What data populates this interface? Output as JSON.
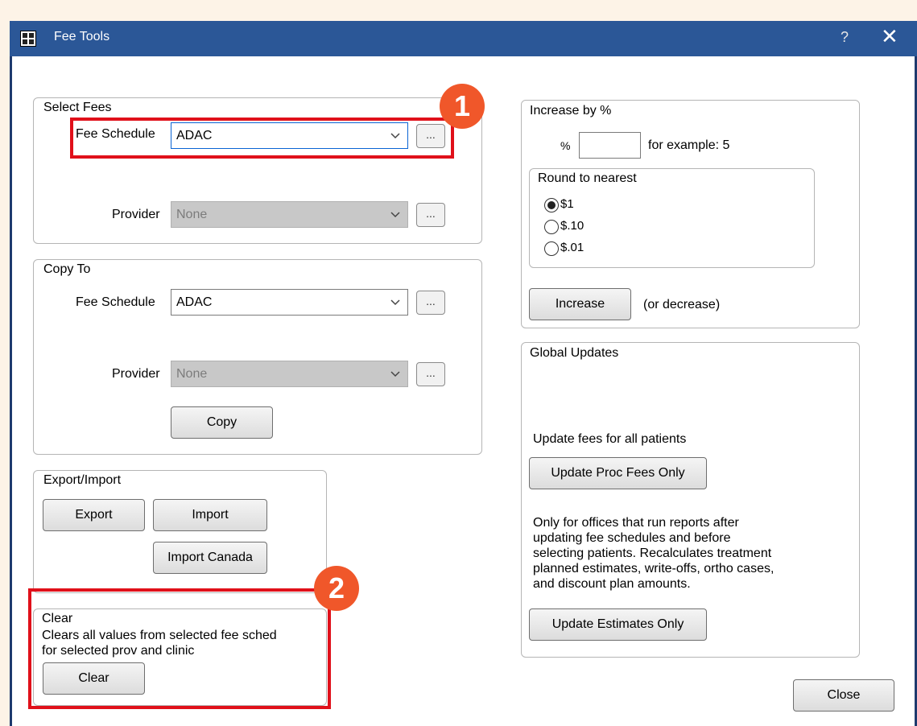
{
  "window": {
    "title": "Fee Tools",
    "help": "?",
    "close": "✕"
  },
  "select_fees": {
    "legend": "Select Fees",
    "fee_schedule_label": "Fee Schedule",
    "fee_schedule_value": "ADAC",
    "provider_label": "Provider",
    "provider_value": "None",
    "ellipsis": "..."
  },
  "copy_to": {
    "legend": "Copy To",
    "fee_schedule_label": "Fee Schedule",
    "fee_schedule_value": "ADAC",
    "provider_label": "Provider",
    "provider_value": "None",
    "ellipsis": "...",
    "copy_button": "Copy"
  },
  "export_import": {
    "legend": "Export/Import",
    "export_button": "Export",
    "import_button": "Import",
    "import_canada_button": "Import Canada"
  },
  "clear": {
    "legend": "Clear",
    "description_line1": "Clears all values from selected fee sched",
    "description_line2": "for selected prov and clinic",
    "clear_button": "Clear"
  },
  "increase": {
    "legend": "Increase by %",
    "percent_label": "%",
    "percent_value": "",
    "example_text": "for example: 5",
    "round_legend": "Round to nearest",
    "round_options": [
      "$1",
      "$.10",
      "$.01"
    ],
    "round_selected": "$1",
    "increase_button": "Increase",
    "decrease_note": "(or decrease)"
  },
  "global_updates": {
    "legend": "Global Updates",
    "update_fees_text": "Update fees for all patients",
    "update_proc_button": "Update Proc Fees Only",
    "info_line1": "Only for offices that run reports after",
    "info_line2": "updating fee schedules and before",
    "info_line3": "selecting patients. Recalculates treatment",
    "info_line4": "planned estimates, write-offs, ortho cases,",
    "info_line5": "and discount plan amounts.",
    "update_estimates_button": "Update Estimates Only"
  },
  "close_button": "Close",
  "callouts": {
    "one": "1",
    "two": "2"
  },
  "colors": {
    "title_bar": "#2b5797",
    "highlight": "#e0101a",
    "badge": "#f0572a"
  }
}
